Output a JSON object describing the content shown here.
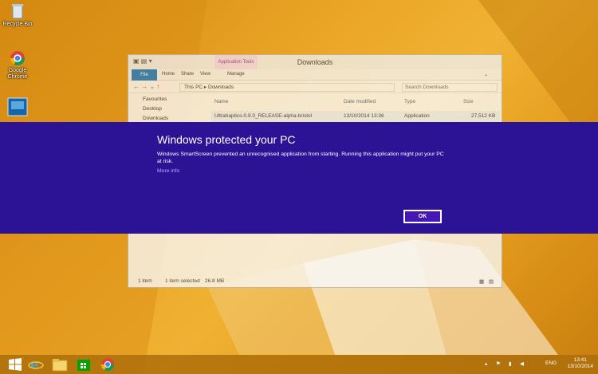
{
  "desktop": {
    "icons": [
      {
        "label": "Recycle Bin",
        "icon": "recycle-bin-icon"
      },
      {
        "label": "Google Chrome",
        "icon": "chrome-icon"
      },
      {
        "label": "",
        "icon": "app-icon"
      }
    ]
  },
  "explorer": {
    "title": "Downloads",
    "context_tab": "Application Tools",
    "ribbon_tabs": [
      "File",
      "Home",
      "Share",
      "View",
      "Manage"
    ],
    "breadcrumb": [
      "This PC",
      "Downloads"
    ],
    "search_placeholder": "Search Downloads",
    "nav_items": [
      "Favourites",
      "Desktop",
      "Downloads"
    ],
    "columns": [
      "Name",
      "Date modified",
      "Type",
      "Size"
    ],
    "rows": [
      {
        "name": "Ultrahaptics-0.9.0_RELEASE-alpha-bristol",
        "date": "13/10/2014 13:36",
        "type": "Application",
        "size": "27,512 KB"
      }
    ],
    "status": {
      "items": "1 item",
      "selected": "1 item selected",
      "size": "26.8 MB"
    }
  },
  "smartscreen": {
    "title": "Windows protected your PC",
    "message": "Windows SmartScreen prevented an unrecognised application from starting. Running this application might put your PC at risk.",
    "more_info": "More info",
    "ok_label": "OK"
  },
  "taskbar": {
    "apps": [
      "start-icon",
      "internet-explorer-icon",
      "file-explorer-icon",
      "store-icon",
      "chrome-icon"
    ],
    "language": "ENG",
    "time": "13:41",
    "date": "13/10/2014"
  },
  "colors": {
    "band": "#2c1395",
    "accent": "#1979ca",
    "wallpaper": "#eaa425"
  }
}
